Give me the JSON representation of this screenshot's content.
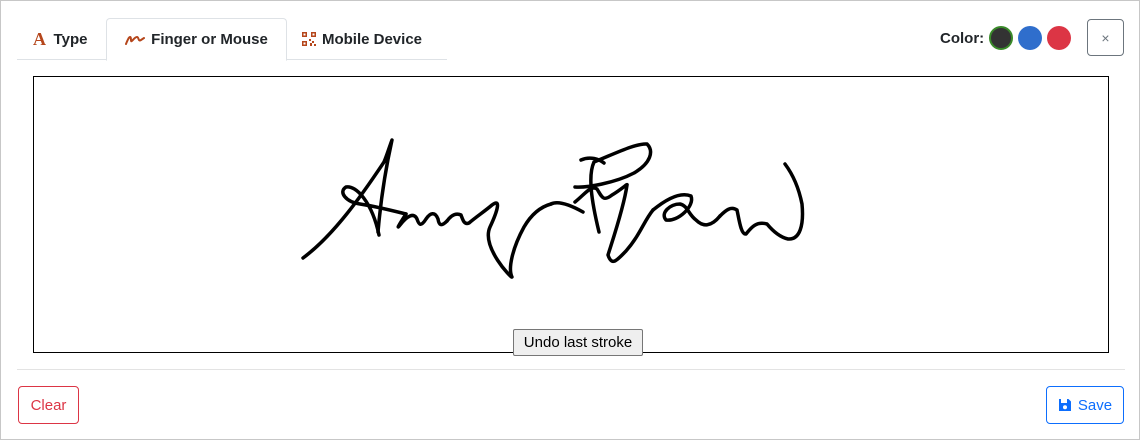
{
  "tabs": [
    {
      "label": "Type",
      "icon": "letter-a-icon",
      "active": false
    },
    {
      "label": "Finger or Mouse",
      "icon": "signature-squiggle-icon",
      "active": true
    },
    {
      "label": "Mobile Device",
      "icon": "qr-code-icon",
      "active": false
    }
  ],
  "colors": {
    "label": "Color:",
    "options": [
      "#333333",
      "#2f6ecc",
      "#dc3545"
    ],
    "selected_border": "#3a8a2a"
  },
  "close": {
    "label": "×",
    "icon": "close-icon"
  },
  "canvas": {
    "undo_label": "Undo last stroke",
    "stroke_color": "#000000"
  },
  "footer": {
    "clear_label": "Clear",
    "save_label": "Save",
    "save_icon": "floppy-disk-icon"
  },
  "accents": {
    "tab_icon": "#b5461b",
    "primary": "#0d6efd",
    "danger": "#dc3545"
  }
}
